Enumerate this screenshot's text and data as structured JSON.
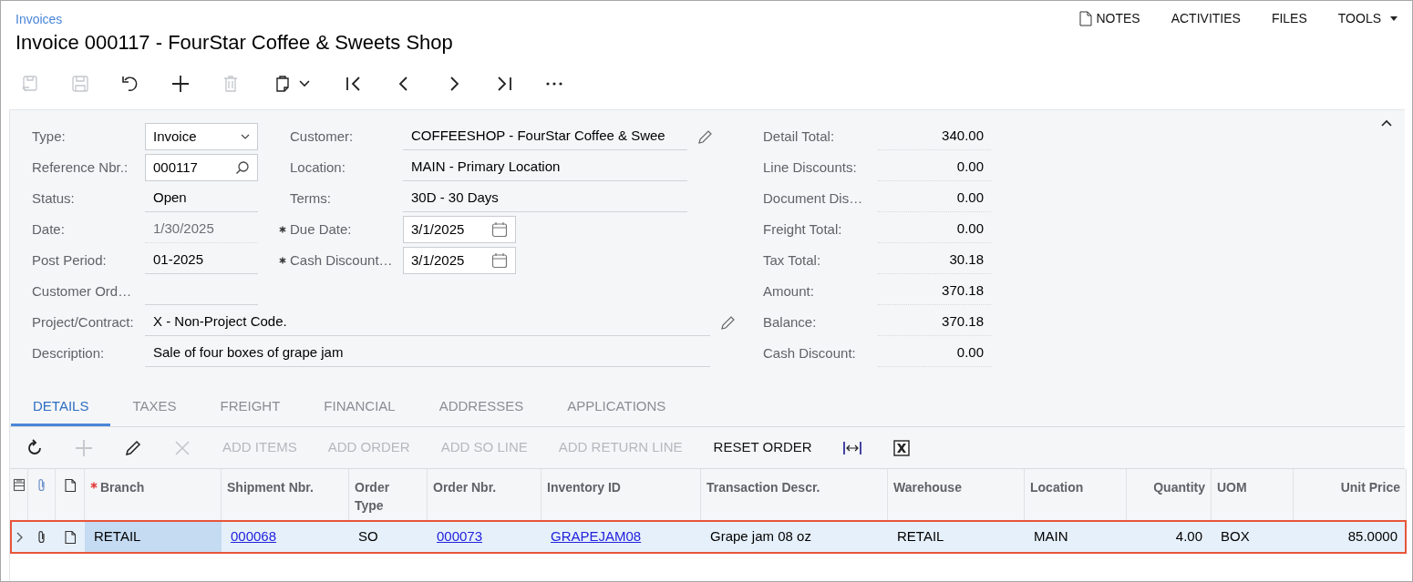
{
  "breadcrumb": "Invoices",
  "title": "Invoice 000117 - FourStar Coffee & Sweets Shop",
  "top_links": [
    {
      "label": "NOTES",
      "kind": "notes"
    },
    {
      "label": "ACTIVITIES",
      "kind": "plain"
    },
    {
      "label": "FILES",
      "kind": "plain"
    },
    {
      "label": "TOOLS",
      "kind": "menu"
    }
  ],
  "toolbar": [
    {
      "kind": "save-close",
      "disabled": true
    },
    {
      "kind": "save",
      "disabled": true
    },
    {
      "kind": "undo",
      "disabled": false
    },
    {
      "kind": "add",
      "disabled": false
    },
    {
      "kind": "delete",
      "disabled": true
    },
    {
      "kind": "clipboard",
      "disabled": false
    },
    {
      "kind": "first",
      "disabled": false
    },
    {
      "kind": "prev",
      "disabled": false
    },
    {
      "kind": "next",
      "disabled": false
    },
    {
      "kind": "last",
      "disabled": false
    },
    {
      "kind": "more",
      "disabled": false
    }
  ],
  "form": {
    "column_1": [
      {
        "label": "Type:",
        "value": "Invoice",
        "kind": "select"
      },
      {
        "label": "Reference Nbr.:",
        "value": "000117",
        "kind": "search"
      },
      {
        "label": "Status:",
        "value": "Open",
        "kind": "text"
      },
      {
        "label": "Date:",
        "value": "1/30/2025",
        "kind": "text",
        "disabled": true
      },
      {
        "label": "Post Period:",
        "value": "01-2025",
        "kind": "text"
      },
      {
        "label": "Customer Ord…",
        "kind": "text"
      }
    ],
    "column_2": [
      {
        "label": "Customer:",
        "value": "COFFEESHOP - FourStar Coffee & Swee",
        "kind": "text",
        "editable": true
      },
      {
        "label": "Location:",
        "value": "MAIN - Primary Location",
        "kind": "text"
      },
      {
        "label": "Terms:",
        "value": "30D - 30 Days",
        "kind": "text"
      },
      {
        "label": "Due Date:",
        "value": "3/1/2025",
        "kind": "date",
        "required": true
      },
      {
        "label": "Cash Discount…",
        "value": "3/1/2025",
        "kind": "date",
        "required": true
      }
    ],
    "wide": [
      {
        "label": "Project/Contract:",
        "value": "X - Non-Project Code.",
        "editable": true
      },
      {
        "label": "Description:",
        "value": "Sale of four boxes of grape jam"
      }
    ],
    "totals": [
      {
        "label": "Detail Total:",
        "value": "340.00"
      },
      {
        "label": "Line Discounts:",
        "value": "0.00"
      },
      {
        "label": "Document Dis…",
        "value": "0.00"
      },
      {
        "label": "Freight Total:",
        "value": "0.00"
      },
      {
        "label": "Tax Total:",
        "value": "30.18"
      },
      {
        "label": "Amount:",
        "value": "370.18"
      },
      {
        "label": "Balance:",
        "value": "370.18"
      },
      {
        "label": "Cash Discount:",
        "value": "0.00"
      }
    ]
  },
  "tabs": [
    {
      "label": "DETAILS",
      "selected": true
    },
    {
      "label": "TAXES",
      "selected": false
    },
    {
      "label": "FREIGHT",
      "selected": false
    },
    {
      "label": "FINANCIAL",
      "selected": false
    },
    {
      "label": "ADDRESSES",
      "selected": false
    },
    {
      "label": "APPLICATIONS",
      "selected": false
    }
  ],
  "grid_toolbar": [
    {
      "kind": "refresh",
      "disabled": false
    },
    {
      "kind": "add",
      "disabled": true
    },
    {
      "kind": "edit",
      "disabled": false
    },
    {
      "kind": "delete",
      "disabled": true
    },
    {
      "kind": "text",
      "label": "ADD ITEMS",
      "disabled": true
    },
    {
      "kind": "text",
      "label": "ADD ORDER",
      "disabled": true
    },
    {
      "kind": "text",
      "label": "ADD SO LINE",
      "disabled": true
    },
    {
      "kind": "text",
      "label": "ADD RETURN LINE",
      "disabled": true
    },
    {
      "kind": "text",
      "label": "RESET ORDER",
      "disabled": false
    },
    {
      "kind": "fit",
      "disabled": false
    },
    {
      "kind": "excel",
      "disabled": false
    }
  ],
  "table": {
    "columns": [
      {
        "label": "Branch",
        "required": true
      },
      {
        "label": "Shipment Nbr."
      },
      {
        "label": "Order Type"
      },
      {
        "label": "Order Nbr."
      },
      {
        "label": "Inventory ID"
      },
      {
        "label": "Transaction Descr."
      },
      {
        "label": "Warehouse"
      },
      {
        "label": "Location"
      },
      {
        "label": "Quantity"
      },
      {
        "label": "UOM"
      },
      {
        "label": "Unit Price"
      }
    ],
    "rows": [
      {
        "selected": true,
        "cells": [
          {
            "text": "RETAIL",
            "link": false,
            "focused": true
          },
          {
            "text": "000068",
            "link": true,
            "focused": false
          },
          {
            "text": "SO",
            "link": false,
            "focused": false
          },
          {
            "text": "000073",
            "link": true,
            "focused": false
          },
          {
            "text": "GRAPEJAM08",
            "link": true,
            "focused": false
          },
          {
            "text": "Grape jam 08 oz",
            "link": false,
            "focused": false
          },
          {
            "text": "RETAIL",
            "link": false,
            "focused": false
          },
          {
            "text": "MAIN",
            "link": false,
            "focused": false
          },
          {
            "text": "4.00",
            "link": false,
            "focused": false
          },
          {
            "text": "BOX",
            "link": false,
            "focused": false
          },
          {
            "text": "85.0000",
            "link": false,
            "focused": false
          }
        ]
      }
    ]
  }
}
